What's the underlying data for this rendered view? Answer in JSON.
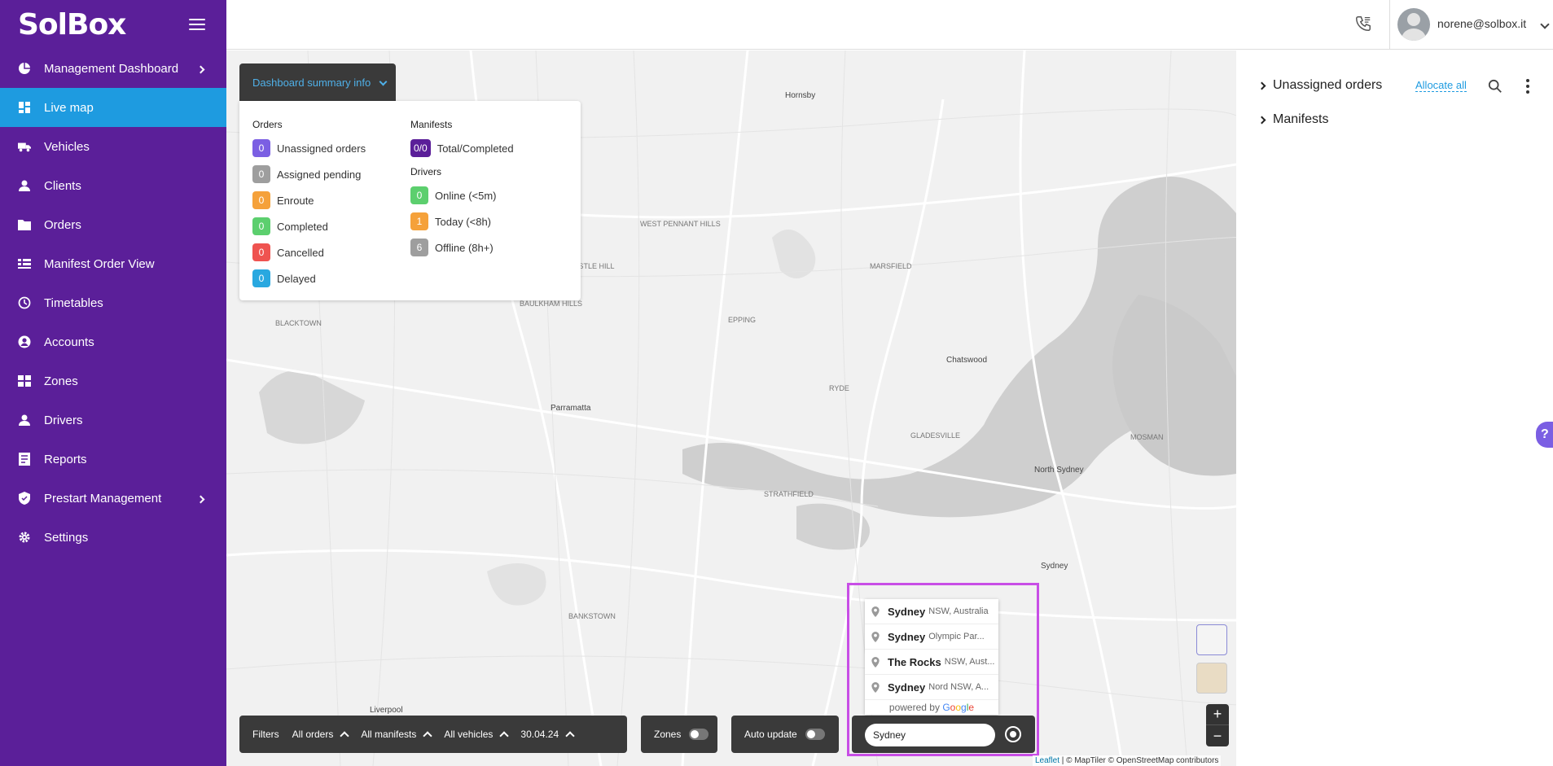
{
  "app": {
    "logo_text": "SolBox"
  },
  "sidebar": {
    "items": [
      {
        "label": "Management Dashboard",
        "icon": "pie-chart-icon"
      },
      {
        "label": "Live map",
        "icon": "dashboard-grid-icon"
      },
      {
        "label": "Vehicles",
        "icon": "truck-icon"
      },
      {
        "label": "Clients",
        "icon": "person-icon"
      },
      {
        "label": "Orders",
        "icon": "folder-icon"
      },
      {
        "label": "Manifest Order View",
        "icon": "list-icon"
      },
      {
        "label": "Timetables",
        "icon": "clock-icon"
      },
      {
        "label": "Accounts",
        "icon": "account-circle-icon"
      },
      {
        "label": "Zones",
        "icon": "grid-icon"
      },
      {
        "label": "Drivers",
        "icon": "person-icon"
      },
      {
        "label": "Reports",
        "icon": "report-icon"
      },
      {
        "label": "Prestart Management",
        "icon": "shield-icon"
      },
      {
        "label": "Settings",
        "icon": "gear-icon"
      }
    ],
    "active": "Live map"
  },
  "header": {
    "user_email": "norene@solbox.it"
  },
  "summary": {
    "toggle_label": "Dashboard summary info",
    "orders_heading": "Orders",
    "orders": [
      {
        "count": "0",
        "label": "Unassigned orders",
        "color": "#7b5fe3"
      },
      {
        "count": "0",
        "label": "Assigned pending",
        "color": "#9e9e9e"
      },
      {
        "count": "0",
        "label": "Enroute",
        "color": "#f5a13a"
      },
      {
        "count": "0",
        "label": "Completed",
        "color": "#5ccf6e"
      },
      {
        "count": "0",
        "label": "Cancelled",
        "color": "#ef5350"
      },
      {
        "count": "0",
        "label": "Delayed",
        "color": "#29a8e0"
      }
    ],
    "manifests_heading": "Manifests",
    "manifests": {
      "count": "0/0",
      "label": "Total/Completed",
      "color": "#5b1f99"
    },
    "drivers_heading": "Drivers",
    "drivers": [
      {
        "count": "0",
        "label": "Online (<5m)",
        "color": "#5ccf6e"
      },
      {
        "count": "1",
        "label": "Today (<8h)",
        "color": "#f5a13a"
      },
      {
        "count": "6",
        "label": "Offline (8h+)",
        "color": "#9e9e9e"
      }
    ]
  },
  "filterbar": {
    "filters_label": "Filters",
    "orders": "All orders",
    "manifests": "All manifests",
    "vehicles": "All vehicles",
    "date": "30.04.24",
    "zones_label": "Zones",
    "auto_update_label": "Auto update"
  },
  "search": {
    "value": "Sydney",
    "suggestions": [
      {
        "main": "Sydney",
        "secondary": "NSW, Australia"
      },
      {
        "main": "Sydney",
        "secondary": "Olympic Par..."
      },
      {
        "main": "The Rocks",
        "secondary": "NSW, Aust..."
      },
      {
        "main": "Sydney",
        "secondary": "Nord NSW, A..."
      }
    ],
    "powered_by": "powered by"
  },
  "map": {
    "labels": [
      "Hornsby",
      "Parramatta",
      "Chatswood",
      "North Sydney",
      "Sydney",
      "Liverpool",
      "WEST PENNANT HILLS",
      "CASTLE HILL",
      "BAULKHAM HILLS",
      "EPPING",
      "RYDE",
      "STRATHFIELD",
      "BANKSTOWN",
      "BLACKTOWN",
      "MARSFIELD",
      "GLADESVILLE",
      "MOSMAN"
    ],
    "attribution": {
      "leaflet": "Leaflet",
      "rest": " | © MapTiler © OpenStreetMap contributors"
    }
  },
  "right_panel": {
    "unassigned_title": "Unassigned orders",
    "allocate_all": "Allocate all",
    "manifests_title": "Manifests"
  },
  "help_label": "?"
}
